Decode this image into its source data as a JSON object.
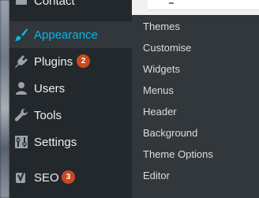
{
  "menu": {
    "contact_label": "Contact",
    "appearance_label": "Appearance",
    "plugins_label": "Plugins",
    "plugins_badge": "2",
    "users_label": "Users",
    "tools_label": "Tools",
    "settings_label": "Settings",
    "seo_label": "SEO",
    "seo_badge": "3",
    "icons": [
      "contact-icon",
      "paintbrush-icon",
      "plugin-icon",
      "user-icon",
      "wrench-icon",
      "settings-icon",
      "yoast-seo-icon"
    ]
  },
  "submenu": {
    "items": [
      "Themes",
      "Customise",
      "Widgets",
      "Menus",
      "Header",
      "Background",
      "Theme Options",
      "Editor"
    ]
  },
  "colors": {
    "sidebar_bg": "#23282d",
    "active_bg": "#32373c",
    "active_text": "#00b9eb",
    "badge": "#ca4a1f"
  }
}
